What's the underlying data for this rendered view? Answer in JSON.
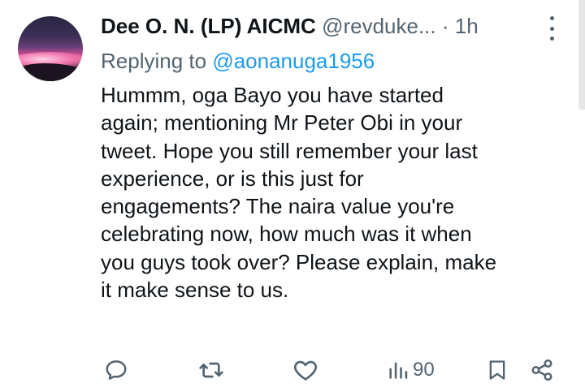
{
  "tweet": {
    "author_name": "Dee O. N. (LP) AICMC",
    "handle": "@revduke...",
    "separator": "·",
    "time": "1h",
    "replying_prefix": "Replying to ",
    "replying_to": "@aonanuga1956",
    "body_lines": [
      "Hummm, oga Bayo you have started",
      "again; mentioning Mr Peter Obi in your",
      "tweet. Hope you still remember your last",
      "experience, or is this just for",
      "engagements? The naira value you're",
      "celebrating now, how much was it when",
      "you guys took over? Please explain, make",
      "it make sense to us."
    ]
  },
  "actions": {
    "views_count": "90"
  },
  "icons": {
    "reply": "reply-icon",
    "retweet": "retweet-icon",
    "like": "heart-icon",
    "views": "views-icon",
    "bookmark": "bookmark-icon",
    "share": "share-icon",
    "more": "more-vertical-icon"
  },
  "colors": {
    "text": "#0f1419",
    "secondary": "#536471",
    "accent": "#1d9bf0"
  }
}
